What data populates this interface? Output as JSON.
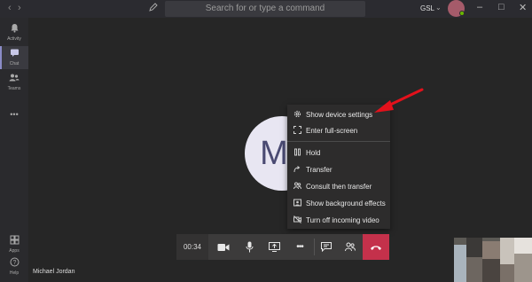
{
  "titlebar": {
    "back_icon": "‹",
    "forward_icon": "›",
    "search_placeholder": "Search for or type a command",
    "org_label": "GSL",
    "org_chevron": "⌄",
    "minimize": "–",
    "maximize": "□",
    "close": "✕"
  },
  "rail": {
    "items": [
      {
        "label": "Activity",
        "icon": "🔔"
      },
      {
        "label": "Chat",
        "icon": "▤"
      },
      {
        "label": "Teams",
        "icon": "👥"
      },
      {
        "label": "•••",
        "icon": ""
      },
      {
        "label": "Apps",
        "icon": "⊞"
      },
      {
        "label": "Help",
        "icon": "?"
      }
    ]
  },
  "call": {
    "avatar_initial": "M",
    "participant_name": "Michael Jordan",
    "timer": "00:34"
  },
  "menu": {
    "items": [
      {
        "label": "Show device settings",
        "icon": "⚙"
      },
      {
        "label": "Enter full-screen",
        "icon": "⛶"
      },
      {
        "label": "Hold",
        "icon": "⏸"
      },
      {
        "label": "Transfer",
        "icon": "↪"
      },
      {
        "label": "Consult then transfer",
        "icon": "⇆"
      },
      {
        "label": "Show background effects",
        "icon": "▣"
      },
      {
        "label": "Turn off incoming video",
        "icon": "⊘"
      }
    ]
  },
  "callbar": {
    "video_icon": "■",
    "mic_icon": "🎤",
    "share_icon": "⬆",
    "more_icon": "•••",
    "chat_icon": "▭",
    "participants_icon": "☷",
    "hangup_icon": "☎"
  },
  "colors": {
    "accent": "#8b8cc7",
    "hangup": "#c4314b",
    "annotation_arrow": "#e3111b"
  }
}
